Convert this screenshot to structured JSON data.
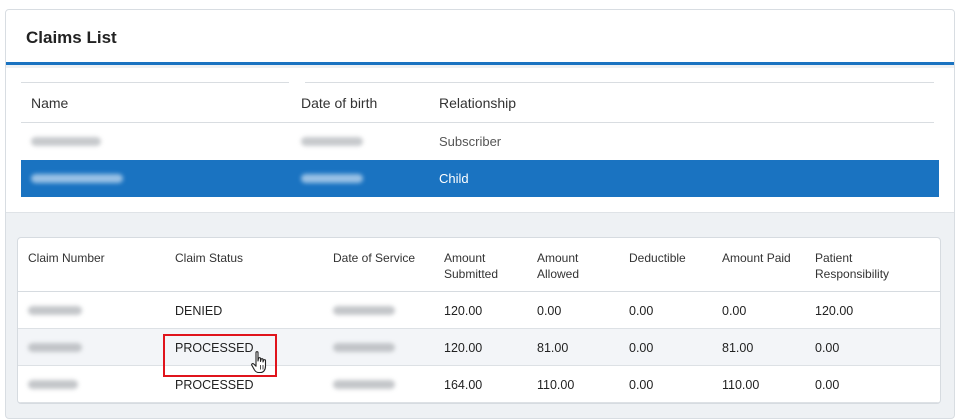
{
  "panel": {
    "title": "Claims List"
  },
  "members": {
    "headers": [
      "Name",
      "Date of birth",
      "Relationship"
    ],
    "rows": [
      {
        "name": "",
        "dob": "",
        "relationship": "Subscriber",
        "selected": false
      },
      {
        "name": "",
        "dob": "",
        "relationship": "Child",
        "selected": true
      }
    ]
  },
  "claims": {
    "headers": [
      "Claim Number",
      "Claim Status",
      "Date of Service",
      "Amount Submitted",
      "Amount Allowed",
      "Deductible",
      "Amount Paid",
      "Patient Responsibility"
    ],
    "rows": [
      {
        "claim_number": "",
        "status": "DENIED",
        "date_of_service": "",
        "submitted": "120.00",
        "allowed": "0.00",
        "deductible": "0.00",
        "paid": "0.00",
        "patient_resp": "120.00"
      },
      {
        "claim_number": "",
        "status": "PROCESSED",
        "date_of_service": "",
        "submitted": "120.00",
        "allowed": "81.00",
        "deductible": "0.00",
        "paid": "81.00",
        "patient_resp": "0.00"
      },
      {
        "claim_number": "",
        "status": "PROCESSED",
        "date_of_service": "",
        "submitted": "164.00",
        "allowed": "110.00",
        "deductible": "0.00",
        "paid": "110.00",
        "patient_resp": "0.00"
      }
    ]
  },
  "colors": {
    "accent": "#1a73c1",
    "highlight": "#e0141c"
  },
  "icons": {
    "cursor": "hand-pointer-icon"
  }
}
